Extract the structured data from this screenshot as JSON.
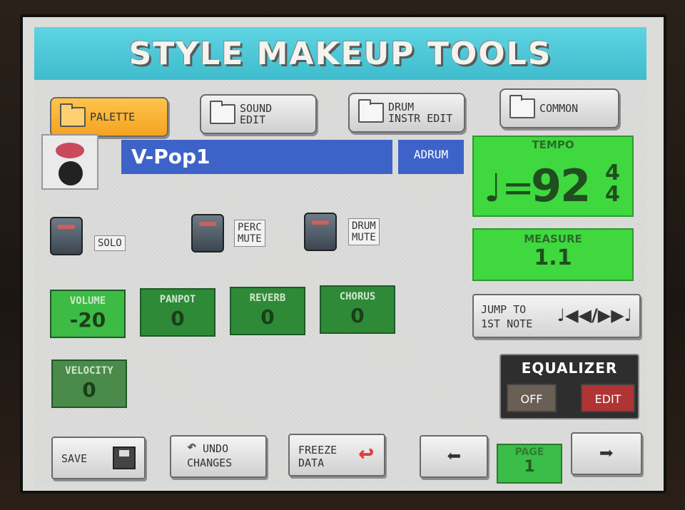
{
  "title": "STYLE MAKEUP TOOLS",
  "tabs": [
    {
      "label_1": "PALETTE",
      "label_2": ""
    },
    {
      "label_1": "SOUND",
      "label_2": "EDIT"
    },
    {
      "label_1": "DRUM",
      "label_2": "INSTR EDIT"
    },
    {
      "label_1": "COMMON",
      "label_2": ""
    }
  ],
  "style": {
    "name": "V-Pop1",
    "track": "ADRUM"
  },
  "tempo": {
    "label": "TEMPO",
    "note": "♩=",
    "value": "92",
    "sig_top": "4",
    "sig_bottom": "4"
  },
  "measure": {
    "label": "MEASURE",
    "value": "1.1"
  },
  "toggles": [
    {
      "label_1": "SOLO",
      "label_2": ""
    },
    {
      "label_1": "PERC",
      "label_2": "MUTE"
    },
    {
      "label_1": "DRUM",
      "label_2": "MUTE"
    }
  ],
  "params": [
    {
      "label": "VOLUME",
      "value": "-20"
    },
    {
      "label": "PANPOT",
      "value": "0"
    },
    {
      "label": "REVERB",
      "value": "0"
    },
    {
      "label": "CHORUS",
      "value": "0"
    },
    {
      "label": "VELOCITY",
      "value": "0"
    }
  ],
  "jump": {
    "label_1": "JUMP TO",
    "label_2": "1ST NOTE",
    "symbol": "♩◀◀/▶▶♩"
  },
  "equalizer": {
    "title": "EQUALIZER",
    "off": "OFF",
    "edit": "EDIT"
  },
  "bottom": {
    "save": "SAVE",
    "undo_1": "UNDO",
    "undo_2": "CHANGES",
    "freeze_1": "FREEZE",
    "freeze_2": "DATA",
    "prev": "⬅",
    "next": "➡",
    "page_label": "PAGE",
    "page_value": "1"
  },
  "colors": {
    "title_bar": "#3fbccd",
    "active_tab": "#f4a320",
    "name_field": "#3e63c8",
    "tempo_bg": "#3fd83f",
    "param_bg": "#2e8a37"
  }
}
